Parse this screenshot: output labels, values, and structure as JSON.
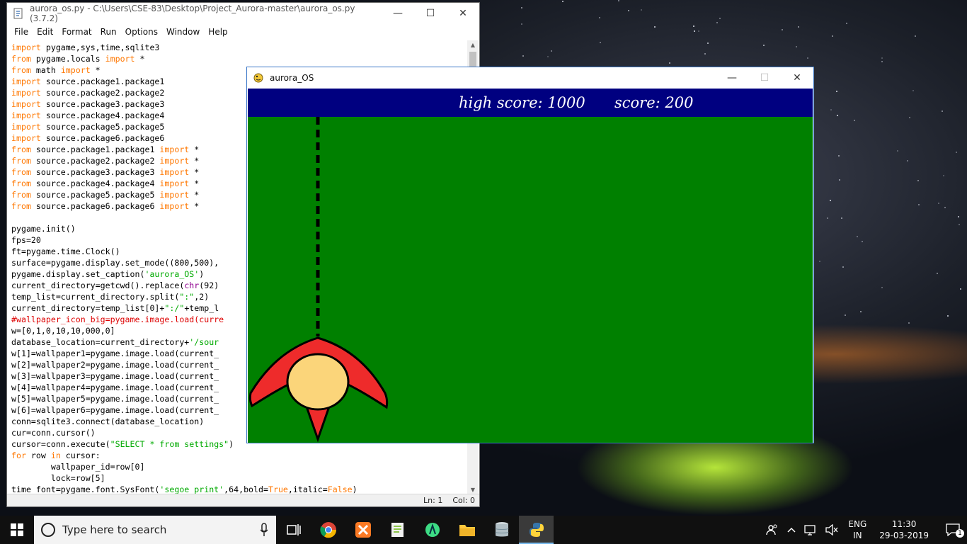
{
  "idle_window": {
    "title": "aurora_os.py - C:\\Users\\CSE-83\\Desktop\\Project_Aurora-master\\aurora_os.py (3.7.2)",
    "menu": [
      "File",
      "Edit",
      "Format",
      "Run",
      "Options",
      "Window",
      "Help"
    ],
    "status_line": "Ln: 1",
    "status_col": "Col: 0",
    "code_lines": [
      [
        [
          "kw",
          "import"
        ],
        [
          "t",
          " pygame,sys,time,sqlite3"
        ]
      ],
      [
        [
          "kw",
          "from"
        ],
        [
          "t",
          " pygame.locals "
        ],
        [
          "kw",
          "import"
        ],
        [
          "t",
          " *"
        ]
      ],
      [
        [
          "kw",
          "from"
        ],
        [
          "t",
          " math "
        ],
        [
          "kw",
          "import"
        ],
        [
          "t",
          " *"
        ]
      ],
      [
        [
          "kw",
          "import"
        ],
        [
          "t",
          " source.package1.package1"
        ]
      ],
      [
        [
          "kw",
          "import"
        ],
        [
          "t",
          " source.package2.package2"
        ]
      ],
      [
        [
          "kw",
          "import"
        ],
        [
          "t",
          " source.package3.package3"
        ]
      ],
      [
        [
          "kw",
          "import"
        ],
        [
          "t",
          " source.package4.package4"
        ]
      ],
      [
        [
          "kw",
          "import"
        ],
        [
          "t",
          " source.package5.package5"
        ]
      ],
      [
        [
          "kw",
          "import"
        ],
        [
          "t",
          " source.package6.package6"
        ]
      ],
      [
        [
          "kw",
          "from"
        ],
        [
          "t",
          " source.package1.package1 "
        ],
        [
          "kw",
          "import"
        ],
        [
          "t",
          " *"
        ]
      ],
      [
        [
          "kw",
          "from"
        ],
        [
          "t",
          " source.package2.package2 "
        ],
        [
          "kw",
          "import"
        ],
        [
          "t",
          " *"
        ]
      ],
      [
        [
          "kw",
          "from"
        ],
        [
          "t",
          " source.package3.package3 "
        ],
        [
          "kw",
          "import"
        ],
        [
          "t",
          " *"
        ]
      ],
      [
        [
          "kw",
          "from"
        ],
        [
          "t",
          " source.package4.package4 "
        ],
        [
          "kw",
          "import"
        ],
        [
          "t",
          " *"
        ]
      ],
      [
        [
          "kw",
          "from"
        ],
        [
          "t",
          " source.package5.package5 "
        ],
        [
          "kw",
          "import"
        ],
        [
          "t",
          " *"
        ]
      ],
      [
        [
          "kw",
          "from"
        ],
        [
          "t",
          " source.package6.package6 "
        ],
        [
          "kw",
          "import"
        ],
        [
          "t",
          " *"
        ]
      ],
      [
        [
          "t",
          ""
        ]
      ],
      [
        [
          "t",
          "pygame.init()"
        ]
      ],
      [
        [
          "t",
          "fps=20"
        ]
      ],
      [
        [
          "t",
          "ft=pygame.time.Clock()"
        ]
      ],
      [
        [
          "t",
          "surface=pygame.display.set_mode((800,500),"
        ]
      ],
      [
        [
          "t",
          "pygame.display.set_caption("
        ],
        [
          "str",
          "'aurora_OS'"
        ],
        [
          "t",
          ")"
        ]
      ],
      [
        [
          "t",
          "current_directory=getcwd().replace("
        ],
        [
          "bi",
          "chr"
        ],
        [
          "t",
          "(92)"
        ]
      ],
      [
        [
          "t",
          "temp_list=current_directory.split("
        ],
        [
          "str",
          "\":\""
        ],
        [
          "t",
          ",2)"
        ]
      ],
      [
        [
          "t",
          "current_directory=temp_list[0]+"
        ],
        [
          "str",
          "\":/\""
        ],
        [
          "t",
          "+temp_l"
        ]
      ],
      [
        [
          "cm",
          "#wallpaper_icon_big=pygame.image.load(curre"
        ]
      ],
      [
        [
          "t",
          "w=[0,1,0,10,10,000,0]"
        ]
      ],
      [
        [
          "t",
          "database_location=current_directory+"
        ],
        [
          "str",
          "'/sour"
        ]
      ],
      [
        [
          "t",
          "w[1]=wallpaper1=pygame.image.load(current_"
        ]
      ],
      [
        [
          "t",
          "w[2]=wallpaper2=pygame.image.load(current_"
        ]
      ],
      [
        [
          "t",
          "w[3]=wallpaper3=pygame.image.load(current_"
        ]
      ],
      [
        [
          "t",
          "w[4]=wallpaper4=pygame.image.load(current_"
        ]
      ],
      [
        [
          "t",
          "w[5]=wallpaper5=pygame.image.load(current_"
        ]
      ],
      [
        [
          "t",
          "w[6]=wallpaper6=pygame.image.load(current_"
        ]
      ],
      [
        [
          "t",
          "conn=sqlite3.connect(database_location)"
        ]
      ],
      [
        [
          "t",
          "cur=conn.cursor()"
        ]
      ],
      [
        [
          "t",
          "cursor=conn.execute("
        ],
        [
          "str",
          "\"SELECT * from settings\""
        ],
        [
          "t",
          ")"
        ]
      ],
      [
        [
          "kw",
          "for"
        ],
        [
          "t",
          " row "
        ],
        [
          "kw",
          "in"
        ],
        [
          "t",
          " cursor:"
        ]
      ],
      [
        [
          "t",
          "        wallpaper_id=row[0]"
        ]
      ],
      [
        [
          "t",
          "        lock=row[5]"
        ]
      ],
      [
        [
          "t",
          "time_font=pygame.font.SysFont("
        ],
        [
          "str",
          "'segoe print'"
        ],
        [
          "t",
          ",64,bold="
        ],
        [
          "kw",
          "True"
        ],
        [
          "t",
          ",italic="
        ],
        [
          "kw",
          "False"
        ],
        [
          "t",
          ")"
        ]
      ]
    ]
  },
  "game_window": {
    "title": "aurora_OS",
    "high_score_label": "high score: 1000",
    "score_label": "score:  200",
    "colors": {
      "background": "#008000",
      "hud": "#000080",
      "ship_wing": "#ee2b2b",
      "ship_body": "#fbd57a"
    }
  },
  "taskbar": {
    "search_placeholder": "Type here to search",
    "apps": [
      "task-view-icon",
      "chrome-icon",
      "xampp-icon",
      "notepad-plus-icon",
      "android-studio-icon",
      "file-explorer-icon",
      "database-icon",
      "python-icon"
    ],
    "lang_top": "ENG",
    "lang_bottom": "IN",
    "time": "11:30",
    "date": "29-03-2019",
    "notification_count": "1"
  }
}
